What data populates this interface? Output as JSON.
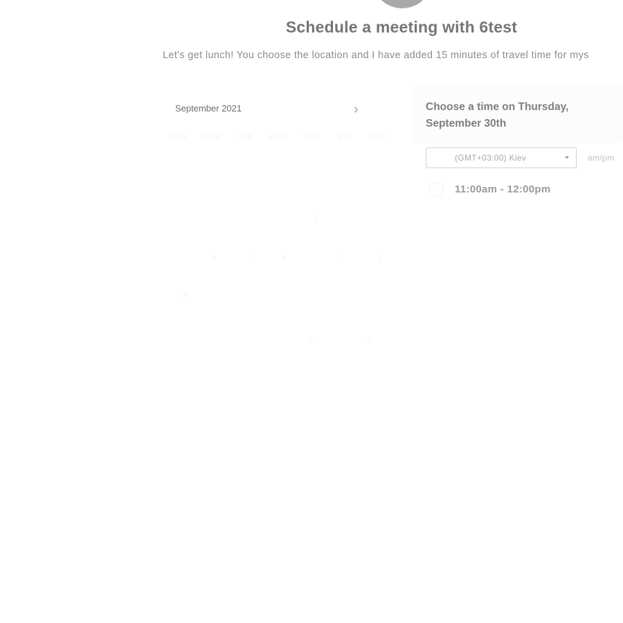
{
  "header": {
    "title": "Schedule a meeting with 6test",
    "description": "Let's get lunch! You choose the location and I have added 15 minutes of travel time for mys"
  },
  "calendar": {
    "month_label": "September 2021",
    "next_icon": "chevron-right-icon",
    "next_glyph": "›",
    "weekdays": [
      "SUN",
      "MON",
      "TUE",
      "WED",
      "THU",
      "FRI",
      "SAT"
    ],
    "faint_days": [
      "2",
      "9",
      "1",
      "6",
      "7",
      "1",
      "4",
      "1",
      "3"
    ]
  },
  "time_panel": {
    "heading": "Choose a time on Thursday, September 30th"
  },
  "timezone": {
    "value": "(GMT+03:00) Kiev",
    "caret_icon": "caret-down-icon"
  },
  "format_toggle": {
    "label": "am/pm"
  },
  "slots": [
    {
      "label": "11:00am - 12:00pm"
    }
  ],
  "colors": {
    "avatar": "#a9a9a9",
    "title": "#757575",
    "text_muted": "#8c8c8c"
  }
}
